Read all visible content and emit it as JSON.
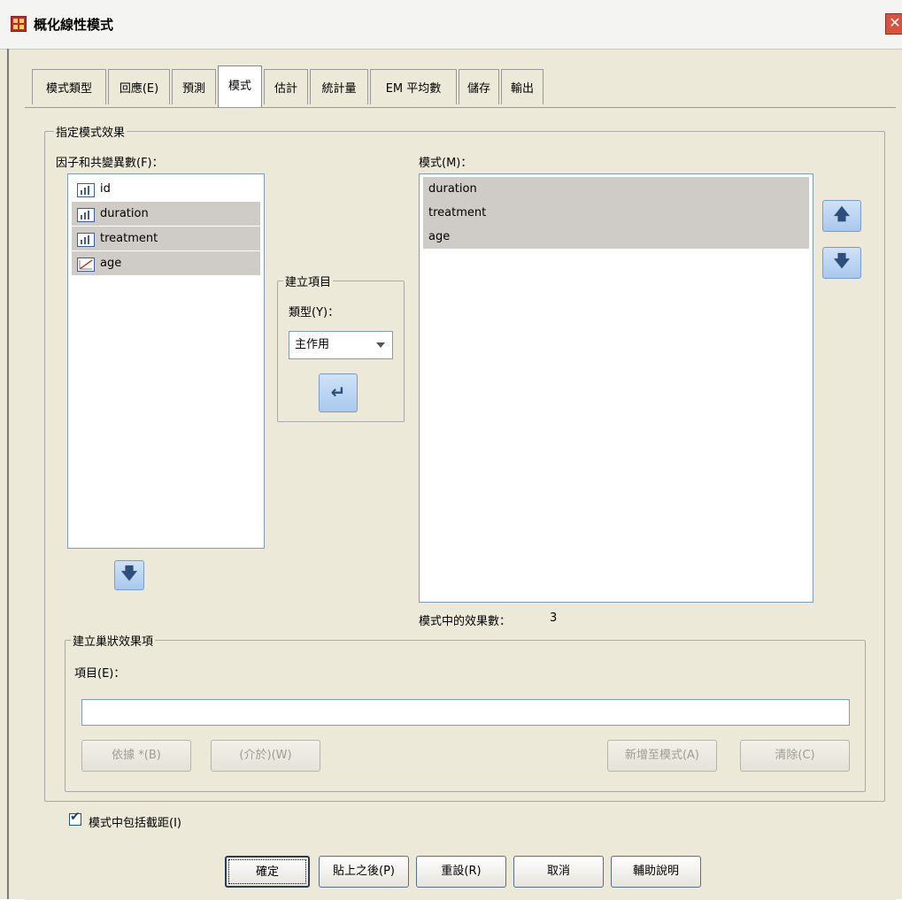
{
  "window": {
    "title": "概化線性模式",
    "close_glyph": "✕"
  },
  "tabs": [
    {
      "label": "模式類型"
    },
    {
      "label": "回應(E)"
    },
    {
      "label": "預測"
    },
    {
      "label": "模式",
      "active": true
    },
    {
      "label": "估計"
    },
    {
      "label": "統計量"
    },
    {
      "label": "EM 平均數"
    },
    {
      "label": "儲存"
    },
    {
      "label": "輸出"
    }
  ],
  "model_effects": {
    "group_title": "指定模式效果",
    "factors_label": "因子和共變異數(F)：",
    "factors": [
      {
        "name": "id",
        "icon": "scale-icon",
        "selected": false
      },
      {
        "name": "duration",
        "icon": "scale-icon",
        "selected": true
      },
      {
        "name": "treatment",
        "icon": "scale-icon",
        "selected": true
      },
      {
        "name": "age",
        "icon": "covariate-icon",
        "selected": true
      }
    ],
    "build_term": {
      "group_title": "建立項目",
      "type_label": "類型(Y)：",
      "type_value": "主作用"
    },
    "model_label": "模式(M)：",
    "model_terms": [
      "duration",
      "treatment",
      "age"
    ],
    "effects_count_label": "模式中的效果數：",
    "effects_count": "3"
  },
  "nested": {
    "group_title": "建立巢狀效果項",
    "term_label": "項目(E)：",
    "term_value": "",
    "by_button": "依據 *(B)",
    "within_button": "(介於)(W)",
    "add_button": "新增至模式(A)",
    "clear_button": "清除(C)"
  },
  "intercept": {
    "label": "模式中包括截距(I)",
    "checked": true,
    "check_glyph": "✔"
  },
  "footer": {
    "ok": "確定",
    "paste": "貼上之後(P)",
    "reset": "重設(R)",
    "cancel": "取消",
    "help": "輔助說明"
  },
  "colors": {
    "selection": "#cfcbc6",
    "dialog_bg": "#ece9d8",
    "blue_button": "#a9c8ee"
  }
}
